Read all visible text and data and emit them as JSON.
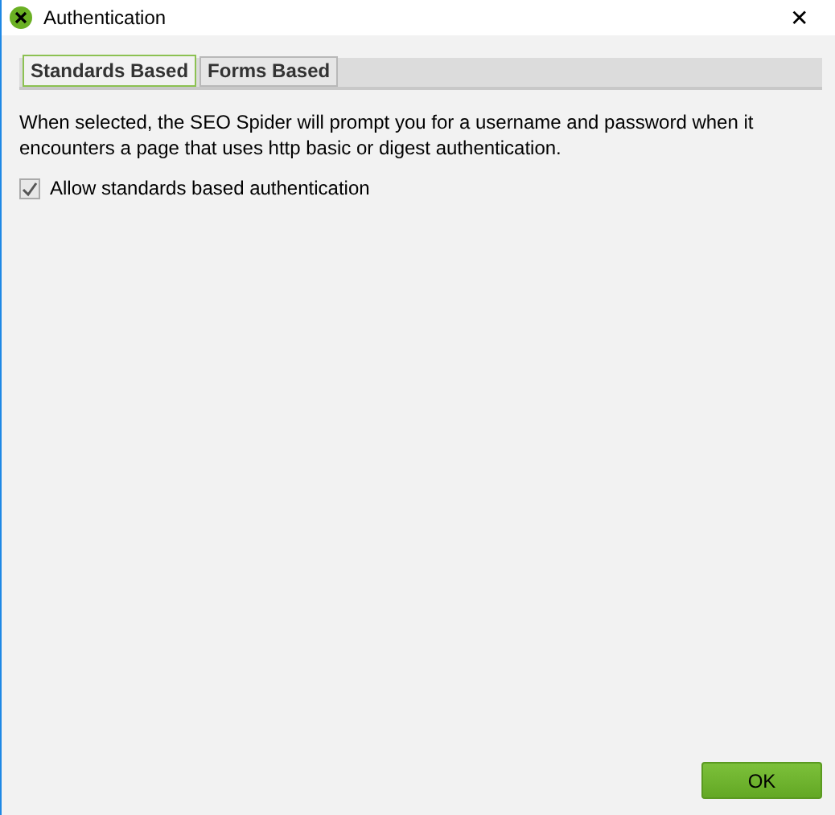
{
  "window": {
    "title": "Authentication",
    "close": "✕"
  },
  "tabs": [
    {
      "label": "Standards Based",
      "selected": true
    },
    {
      "label": "Forms Based",
      "selected": false
    }
  ],
  "description": "When selected, the SEO Spider will prompt you for a username and password when it encounters a page that uses http basic or digest authentication.",
  "checkbox": {
    "label": "Allow standards based authentication",
    "checked": true
  },
  "buttons": [
    "OK"
  ]
}
